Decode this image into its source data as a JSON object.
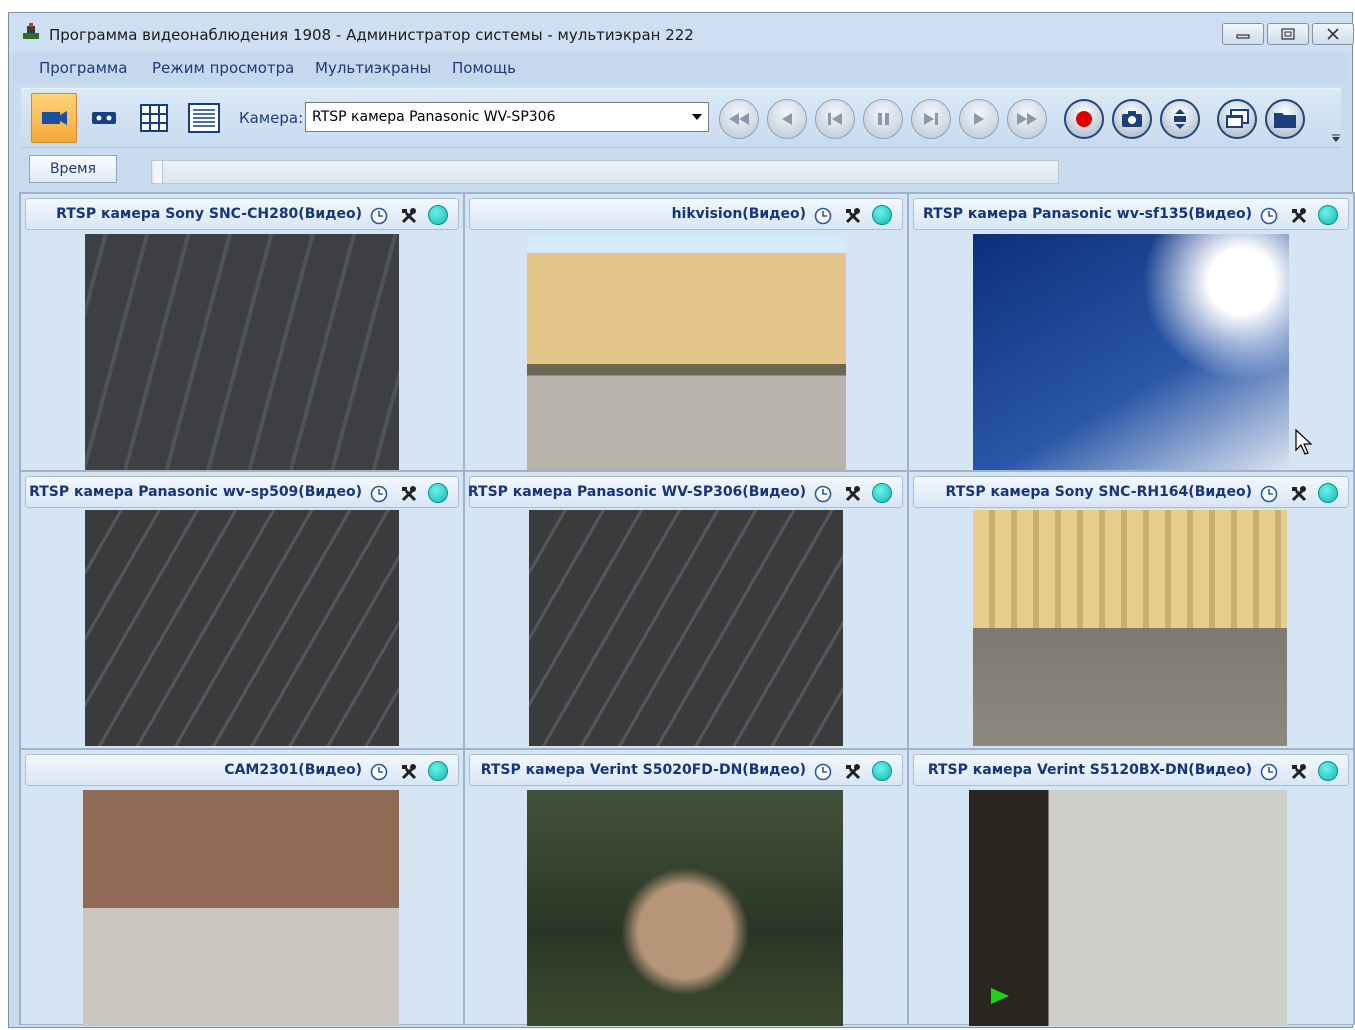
{
  "window": {
    "title": "Программа видеонаблюдения 1908 - Администратор системы - мультиэкран 222",
    "controls": [
      "minimize-icon",
      "maximize-icon",
      "close-icon"
    ]
  },
  "menu": {
    "items": [
      "Программа",
      "Режим просмотра",
      "Мультиэкраны",
      "Помощь"
    ]
  },
  "toolbar": {
    "camera_label": "Камера:",
    "camera_value": "RTSP камера Panasonic WV-SP306",
    "layout_buttons": [
      "single-view-icon",
      "double-view-icon",
      "grid-view-icon",
      "list-view-icon"
    ],
    "playback_buttons": [
      "rewind-icon",
      "step-back-icon",
      "skip-start-icon",
      "pause-icon",
      "skip-end-icon",
      "play-icon",
      "fast-forward-icon"
    ],
    "action_buttons": [
      "record-icon",
      "snapshot-icon",
      "fit-icon",
      "windows-icon",
      "folder-icon"
    ]
  },
  "timebar": {
    "time_button": "Время"
  },
  "cameras": [
    {
      "title": "RTSP камера Sony SNC-CH280(Видео)",
      "scene": "street"
    },
    {
      "title": "hikvision(Видео)",
      "scene": "building"
    },
    {
      "title": "RTSP камера Panasonic wv-sf135(Видео)",
      "scene": "tower"
    },
    {
      "title": "RTSP камера Panasonic wv-sp509(Видео)",
      "scene": "road"
    },
    {
      "title": "RTSP камера Panasonic WV-SP306(Видео)",
      "scene": "road"
    },
    {
      "title": "RTSP камера Sony SNC-RH164(Видео)",
      "scene": "columns"
    },
    {
      "title": "CAM2301(Видео)",
      "scene": "nevsky"
    },
    {
      "title": "RTSP камера Verint S5020FD-DN(Видео)",
      "scene": "park"
    },
    {
      "title": "RTSP камера Verint S5120BX-DN(Видео)",
      "scene": "office"
    }
  ],
  "colors": {
    "accent": "#17357a",
    "status_online": "#19c6bf",
    "record": "#e00000",
    "active_button": "#f6a938"
  }
}
